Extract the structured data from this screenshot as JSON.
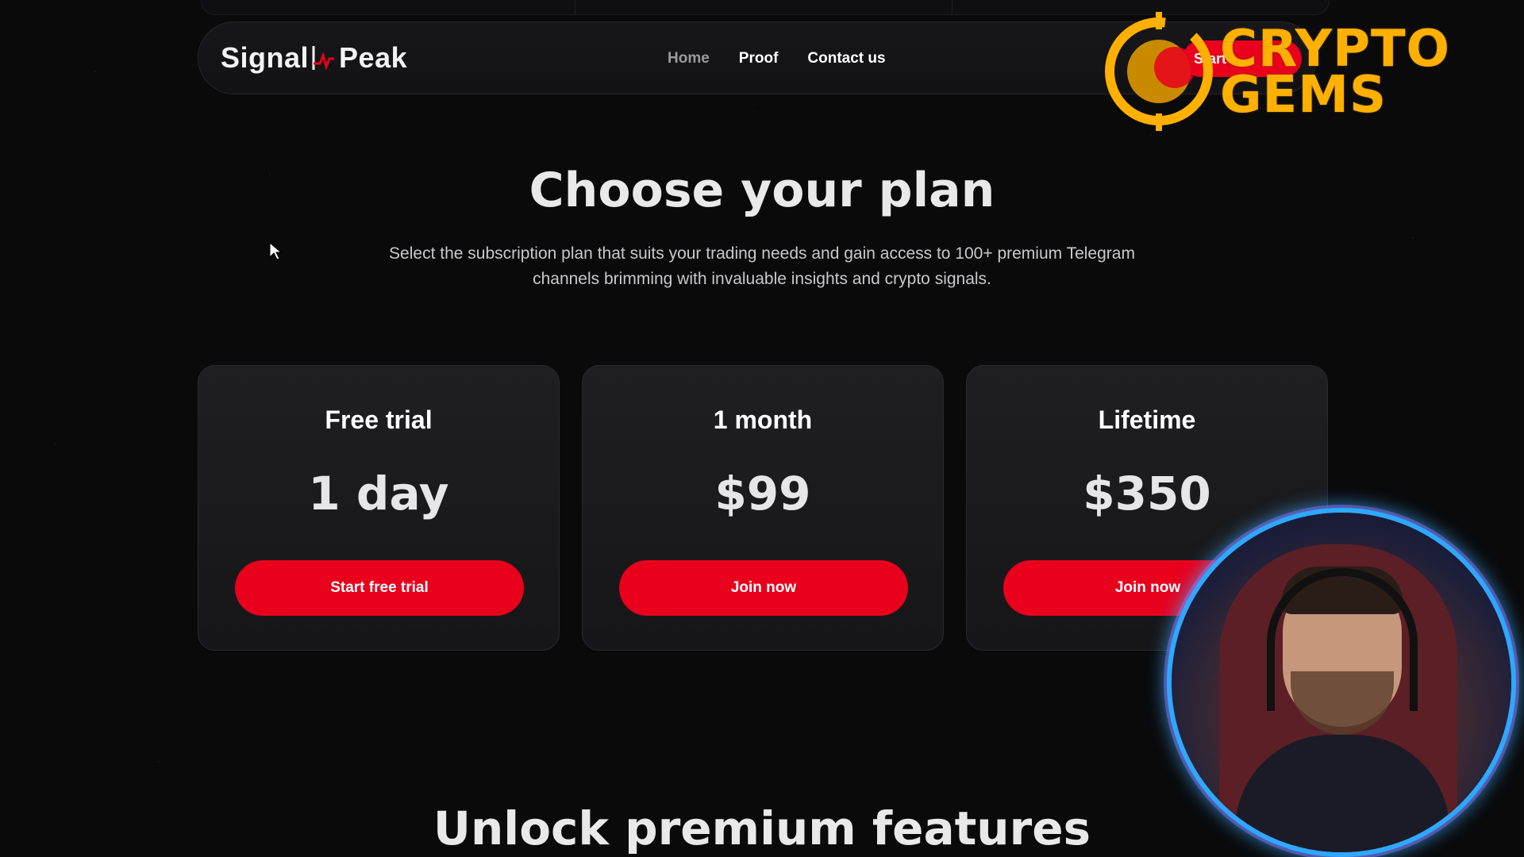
{
  "brand": {
    "logo_text_left": "Signal",
    "logo_text_right": "Peak"
  },
  "nav": {
    "links": [
      {
        "label": "Home"
      },
      {
        "label": "Proof"
      },
      {
        "label": "Contact us"
      }
    ],
    "cta_label": "Start"
  },
  "overlay": {
    "line1": "CRYPTO",
    "line2": "GEMS"
  },
  "hero": {
    "title": "Choose your plan",
    "subtitle": "Select the subscription plan that suits your trading needs and gain access to 100+ premium Telegram channels brimming with invaluable insights and crypto signals."
  },
  "plans": [
    {
      "name": "Free trial",
      "price": "1 day",
      "button": "Start free trial"
    },
    {
      "name": "1 month",
      "price": "$99",
      "button": "Join now"
    },
    {
      "name": "Lifetime",
      "price": "$350",
      "button": "Join now"
    }
  ],
  "features": {
    "title": "Unlock premium features"
  },
  "colors": {
    "accent": "#e8001c",
    "background": "#0a0a0b",
    "overlay_gold": "#ffb000"
  }
}
